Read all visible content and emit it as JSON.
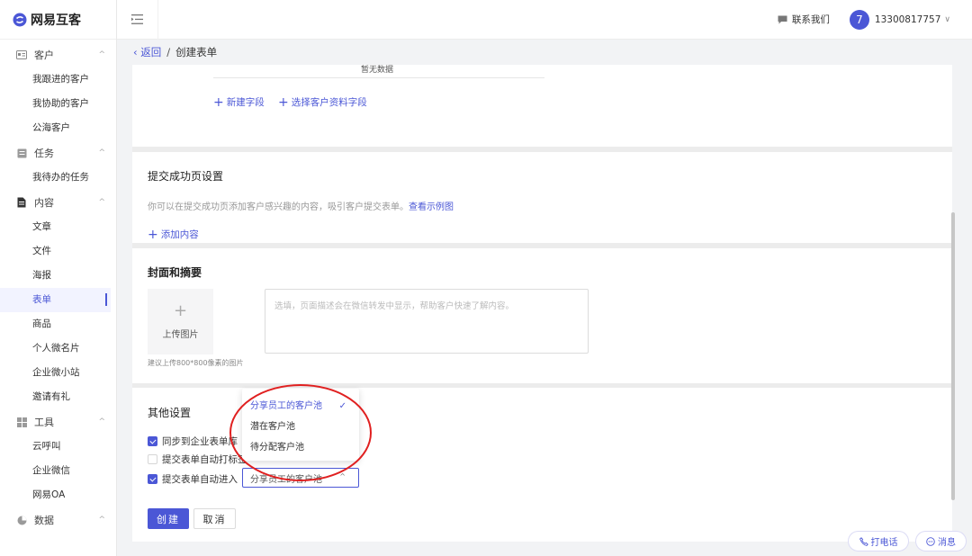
{
  "brand": {
    "name": "网易互客"
  },
  "sidebar": {
    "groups": [
      {
        "label": "客户",
        "items": [
          "我跟进的客户",
          "我协助的客户",
          "公海客户"
        ]
      },
      {
        "label": "任务",
        "items": [
          "我待办的任务"
        ]
      },
      {
        "label": "内容",
        "items": [
          "文章",
          "文件",
          "海报",
          "表单",
          "商品",
          "个人微名片",
          "企业微小站",
          "邀请有礼"
        ]
      },
      {
        "label": "工具",
        "items": [
          "云呼叫",
          "企业微信",
          "网易OA"
        ]
      },
      {
        "label": "数据",
        "items": []
      }
    ],
    "active_item": "表单"
  },
  "header": {
    "contact_label": "联系我们",
    "avatar_text": "7",
    "phone": "13300817757"
  },
  "breadcrumb": {
    "back": "返回",
    "separator": "/",
    "current": "创建表单"
  },
  "section_fields": {
    "cut_text": "暂无数据",
    "new_field": "新建字段",
    "choose_field": "选择客户资料字段"
  },
  "section_success": {
    "title": "提交成功页设置",
    "hint": "你可以在提交成功页添加客户感兴趣的内容，吸引客户提交表单。",
    "example_link": "查看示例图",
    "add_content": "添加内容"
  },
  "section_cover": {
    "title": "封面和摘要",
    "upload_label": "上传图片",
    "upload_note": "建议上传800*800像素的图片",
    "desc_placeholder": "选填，页面描述会在微信转发中显示，帮助客户快速了解内容。"
  },
  "section_other": {
    "title": "其他设置",
    "options": [
      {
        "label": "同步到企业表单库",
        "checked": true
      },
      {
        "label": "提交表单自动打标签",
        "checked": false
      },
      {
        "label": "提交表单自动进入",
        "checked": true
      }
    ],
    "select_value": "分享员工的客户池"
  },
  "dropdown": {
    "options": [
      "分享员工的客户池",
      "潜在客户池",
      "待分配客户池"
    ],
    "selected": "分享员工的客户池"
  },
  "actions": {
    "create": "创建",
    "cancel": "取消"
  },
  "floating": {
    "call": "打电话",
    "message": "消息"
  },
  "colors": {
    "accent": "#4b57d6",
    "annotation": "#e02020"
  }
}
